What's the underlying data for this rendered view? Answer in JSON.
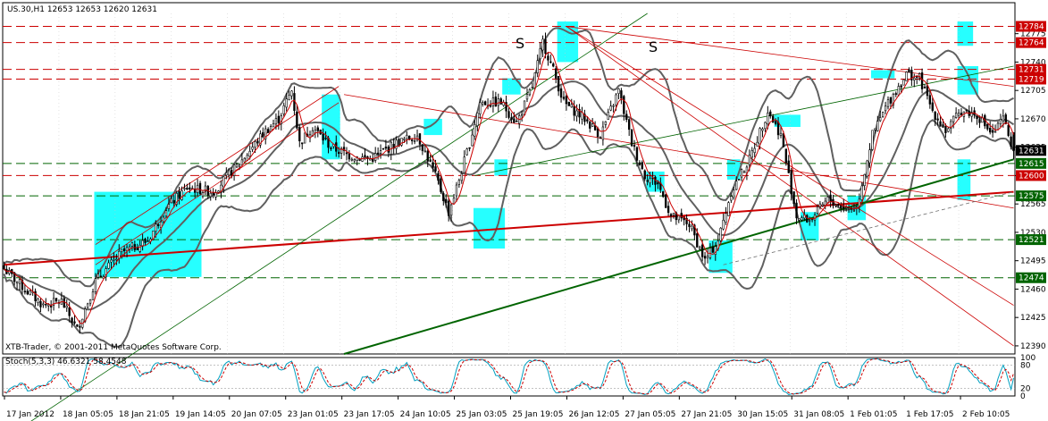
{
  "header": {
    "symbol_line": "US.30,H1  12653 12653 12620 12631",
    "watermark": "XTB-Trader, © 2001-2011 MetaQuotes Software Corp.",
    "stoch_label": "Stoch(5,3,3) 46.6321 58.4548"
  },
  "annotations": {
    "s1": "S",
    "s2": "S"
  },
  "colors": {
    "bull": "#000000",
    "bear": "#000000",
    "ma": "#cc0000",
    "bands": "#606060",
    "cyan": "#00ffff",
    "green": "#006400",
    "red": "#cc0000",
    "stoch_main": "#00a0c0",
    "stoch_signal": "#cc0000"
  },
  "chart_data": {
    "type": "candlestick",
    "instrument": "US.30,H1",
    "last_bar": {
      "open": 12653,
      "high": 12653,
      "low": 12620,
      "close": 12631
    },
    "ylim": [
      12380,
      12800
    ],
    "price_ticks": [
      "12775",
      "12740",
      "12705",
      "12670",
      "12635",
      "12600",
      "12565",
      "12530",
      "12495",
      "12460",
      "12425",
      "12390"
    ],
    "time_ticks": [
      "17 Jan 2012",
      "18 Jan 05:05",
      "18 Jan 21:05",
      "19 Jan 14:05",
      "20 Jan 07:05",
      "23 Jan 01:05",
      "23 Jan 17:05",
      "24 Jan 10:05",
      "25 Jan 03:05",
      "25 Jan 19:05",
      "26 Jan 12:05",
      "27 Jan 05:05",
      "27 Jan 21:05",
      "30 Jan 15:05",
      "31 Jan 08:05",
      "1 Feb 01:05",
      "1 Feb 17:05",
      "2 Feb 10:05"
    ],
    "close_anchors": [
      [
        0,
        12485
      ],
      [
        8,
        12460
      ],
      [
        15,
        12440
      ],
      [
        22,
        12445
      ],
      [
        28,
        12410
      ],
      [
        35,
        12470
      ],
      [
        45,
        12505
      ],
      [
        55,
        12520
      ],
      [
        62,
        12560
      ],
      [
        70,
        12585
      ],
      [
        80,
        12580
      ],
      [
        90,
        12615
      ],
      [
        100,
        12655
      ],
      [
        105,
        12670
      ],
      [
        110,
        12705
      ],
      [
        113,
        12640
      ],
      [
        118,
        12660
      ],
      [
        125,
        12635
      ],
      [
        132,
        12625
      ],
      [
        140,
        12620
      ],
      [
        150,
        12640
      ],
      [
        158,
        12650
      ],
      [
        165,
        12600
      ],
      [
        170,
        12555
      ],
      [
        174,
        12595
      ],
      [
        178,
        12640
      ],
      [
        182,
        12690
      ],
      [
        190,
        12690
      ],
      [
        196,
        12665
      ],
      [
        202,
        12710
      ],
      [
        206,
        12765
      ],
      [
        210,
        12730
      ],
      [
        214,
        12690
      ],
      [
        222,
        12670
      ],
      [
        228,
        12650
      ],
      [
        235,
        12705
      ],
      [
        240,
        12640
      ],
      [
        245,
        12600
      ],
      [
        250,
        12590
      ],
      [
        255,
        12550
      ],
      [
        262,
        12540
      ],
      [
        268,
        12495
      ],
      [
        273,
        12520
      ],
      [
        278,
        12580
      ],
      [
        285,
        12620
      ],
      [
        292,
        12680
      ],
      [
        297,
        12650
      ],
      [
        303,
        12550
      ],
      [
        308,
        12545
      ],
      [
        315,
        12570
      ],
      [
        322,
        12560
      ],
      [
        326,
        12560
      ],
      [
        332,
        12650
      ],
      [
        338,
        12690
      ],
      [
        345,
        12725
      ],
      [
        350,
        12720
      ],
      [
        355,
        12680
      ],
      [
        360,
        12655
      ],
      [
        366,
        12680
      ],
      [
        372,
        12675
      ],
      [
        378,
        12650
      ],
      [
        382,
        12670
      ],
      [
        386,
        12631
      ]
    ],
    "horizontal_levels": [
      {
        "price": 12784,
        "label": "12784",
        "style": "dash",
        "color": "#cc0000"
      },
      {
        "price": 12764,
        "label": "12764",
        "style": "dash",
        "color": "#cc0000"
      },
      {
        "price": 12731,
        "label": "12731",
        "style": "dash",
        "color": "#cc0000"
      },
      {
        "price": 12719,
        "label": "12719",
        "style": "dash",
        "color": "#cc0000"
      },
      {
        "price": 12615,
        "label": "12615",
        "style": "dash",
        "color": "#006400"
      },
      {
        "price": 12600,
        "label": "12600",
        "style": "dash",
        "color": "#cc0000"
      },
      {
        "price": 12575,
        "label": "12575",
        "style": "dash",
        "color": "#006400"
      },
      {
        "price": 12521,
        "label": "12521",
        "style": "dash",
        "color": "#006400"
      },
      {
        "price": 12474,
        "label": "12474",
        "style": "dash",
        "color": "#006400"
      }
    ],
    "current_price": {
      "price": 12631,
      "label": "12631"
    },
    "trendlines": [
      {
        "from": [
          0,
          12490
        ],
        "to": [
          386,
          12580
        ],
        "color": "#cc0000",
        "width": 2
      },
      {
        "from": [
          130,
          12380
        ],
        "to": [
          386,
          12620
        ],
        "color": "#006400",
        "width": 2
      },
      {
        "from": [
          0,
          12275
        ],
        "to": [
          246,
          12800
        ],
        "color": "#006400",
        "width": 0.8
      },
      {
        "from": [
          35,
          12515
        ],
        "to": [
          128,
          12710
        ],
        "color": "#cc0000",
        "width": 0.8
      },
      {
        "from": [
          35,
          12490
        ],
        "to": [
          128,
          12690
        ],
        "color": "#cc0000",
        "width": 0.8
      },
      {
        "from": [
          130,
          12700
        ],
        "to": [
          386,
          12560
        ],
        "color": "#cc0000",
        "width": 0.8
      },
      {
        "from": [
          215,
          12784
        ],
        "to": [
          386,
          12710
        ],
        "color": "#cc0000",
        "width": 0.8
      },
      {
        "from": [
          215,
          12784
        ],
        "to": [
          386,
          12390
        ],
        "color": "#cc0000",
        "width": 0.8
      },
      {
        "from": [
          180,
          12600
        ],
        "to": [
          386,
          12735
        ],
        "color": "#006400",
        "width": 0.8
      },
      {
        "from": [
          215,
          12784
        ],
        "to": [
          386,
          12440
        ],
        "color": "#cc0000",
        "width": 0.8
      },
      {
        "from": [
          275,
          12490
        ],
        "to": [
          386,
          12580
        ],
        "color": "#707070",
        "width": 0.8,
        "dash": true
      }
    ],
    "highlight_boxes": [
      {
        "from": [
          35,
          12580
        ],
        "to": [
          75,
          12475
        ]
      },
      {
        "from": [
          122,
          12700
        ],
        "to": [
          128,
          12620
        ]
      },
      {
        "from": [
          161,
          12670
        ],
        "to": [
          167,
          12650
        ]
      },
      {
        "from": [
          180,
          12560
        ],
        "to": [
          191,
          12510
        ]
      },
      {
        "from": [
          188,
          12620
        ],
        "to": [
          192,
          12600
        ]
      },
      {
        "from": [
          191,
          12720
        ],
        "to": [
          197,
          12700
        ]
      },
      {
        "from": [
          212,
          12790
        ],
        "to": [
          219,
          12740
        ]
      },
      {
        "from": [
          246,
          12605
        ],
        "to": [
          252,
          12580
        ]
      },
      {
        "from": [
          270,
          12520
        ],
        "to": [
          278,
          12480
        ]
      },
      {
        "from": [
          277,
          12620
        ],
        "to": [
          281,
          12595
        ]
      },
      {
        "from": [
          295,
          12675
        ],
        "to": [
          304,
          12660
        ]
      },
      {
        "from": [
          305,
          12555
        ],
        "to": [
          311,
          12520
        ]
      },
      {
        "from": [
          323,
          12575
        ],
        "to": [
          329,
          12545
        ]
      },
      {
        "from": [
          332,
          12730
        ],
        "to": [
          340,
          12720
        ]
      },
      {
        "from": [
          365,
          12790
        ],
        "to": [
          370,
          12760
        ]
      },
      {
        "from": [
          365,
          12735
        ],
        "to": [
          372,
          12700
        ]
      },
      {
        "from": [
          365,
          12620
        ],
        "to": [
          369,
          12590
        ]
      },
      {
        "from": [
          365,
          12590
        ],
        "to": [
          369,
          12570
        ]
      }
    ],
    "stoch": {
      "k": 5,
      "d": 3,
      "slowing": 3,
      "main": 46.6321,
      "signal": 58.4548,
      "levels": [
        80,
        20
      ],
      "ylim": [
        0,
        100
      ],
      "ticks": [
        "100",
        "80",
        "20",
        "0"
      ]
    }
  }
}
